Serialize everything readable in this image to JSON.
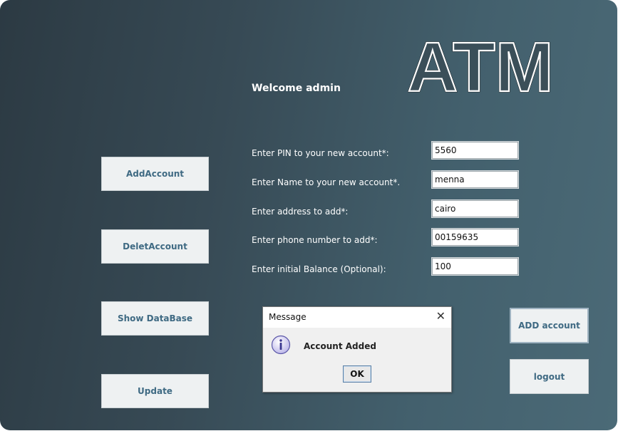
{
  "logo": {
    "text": "ATM"
  },
  "welcome": "Welcome admin",
  "sidebar": {
    "add_account": "AddAccount",
    "delete_account": "DeletAccount",
    "show_database": "Show DataBase",
    "update": "Update"
  },
  "form": {
    "pin": {
      "label": "Enter PIN to your new account*:",
      "value": "5560"
    },
    "name": {
      "label": "Enter Name to your new account*.",
      "value": "menna"
    },
    "address": {
      "label": "Enter address to add*:",
      "value": "cairo"
    },
    "phone": {
      "label": "Enter phone number to add*:",
      "value": "00159635"
    },
    "balance": {
      "label": "Enter initial Balance (Optional):",
      "value": "100"
    }
  },
  "actions": {
    "add_account": "ADD account",
    "logout": "logout"
  },
  "dialog": {
    "title": "Message",
    "close": "✕",
    "message": "Account Added",
    "ok": "OK",
    "icon": "info-icon"
  },
  "colors": {
    "panel_dark": "#2c3a43",
    "panel_light": "#4b6a77",
    "button_text": "#3f6a83"
  }
}
